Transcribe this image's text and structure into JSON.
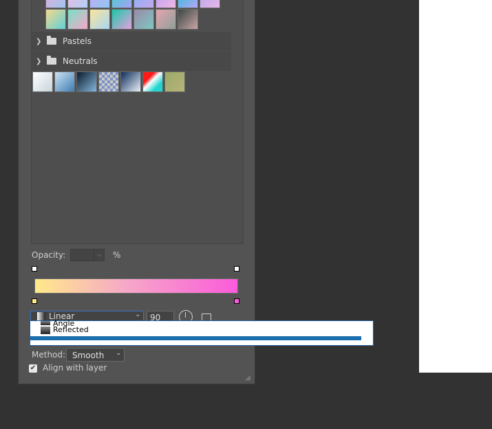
{
  "folders": [
    {
      "label": "Pastels"
    },
    {
      "label": "Neutrals"
    }
  ],
  "top_swatches_row1": [
    "linear-gradient(135deg,#e9a9d9,#9ec6f0)",
    "linear-gradient(135deg,#f2b8e0,#b0d0f5)",
    "linear-gradient(135deg,#cba6f6,#8ec8f3)",
    "linear-gradient(135deg,#34d6c4,#a9a1f7)",
    "linear-gradient(135deg,#7fb2f4,#c7a7ef)",
    "linear-gradient(135deg,#b8a0f8,#f0b6e0)",
    "linear-gradient(135deg,#26c0d6,#b6a5f6)",
    "linear-gradient(135deg,#b4a6ea,#e7b8e6)"
  ],
  "top_swatches_row2": [
    "linear-gradient(135deg,#f6d98d,#5fd0d8)",
    "linear-gradient(135deg,#76e1c9,#f9a6c7)",
    "linear-gradient(135deg,#fde59b,#a7d6f4)",
    "linear-gradient(135deg,#17c9a6,#e8a0e1)",
    "linear-gradient(135deg,#9b8aa7,#7ec7c2)",
    "linear-gradient(135deg,#e4a5b0,#8f9f9a)",
    "linear-gradient(135deg,#3a4744,#c9a5a6)"
  ],
  "neutral_swatches": [
    "linear-gradient(135deg,#ffffff,#c8d4dc)",
    "linear-gradient(135deg,#cfe3f3,#3d7db3)",
    "linear-gradient(135deg,#0a1a2e,#86b6d9)",
    "repeating-conic-gradient(#c8c8c8 0% 25%, #7c93c8 0% 50%) 0 0/8px 8px",
    "linear-gradient(135deg,#0e2c5a,#e9f1f8)",
    "linear-gradient(135deg,#ff1a1a 30%,#ffffff 45%,#1fd6cf 75%)",
    "linear-gradient(135deg,#9aab66,#b8b37b)"
  ],
  "opacity": {
    "label": "Opacity:",
    "value": "",
    "unit": "%"
  },
  "gradient": {
    "left_color": "#ffe98a",
    "right_color": "#fb5bdb"
  },
  "style_select": {
    "value": "Linear"
  },
  "angle": {
    "value": "90"
  },
  "dropdown_items": [
    {
      "label": "Angle"
    },
    {
      "label": "Reflected"
    }
  ],
  "method": {
    "label": "Method:",
    "value": "Smooth"
  },
  "align": {
    "label": "Align with layer",
    "checked": true
  }
}
